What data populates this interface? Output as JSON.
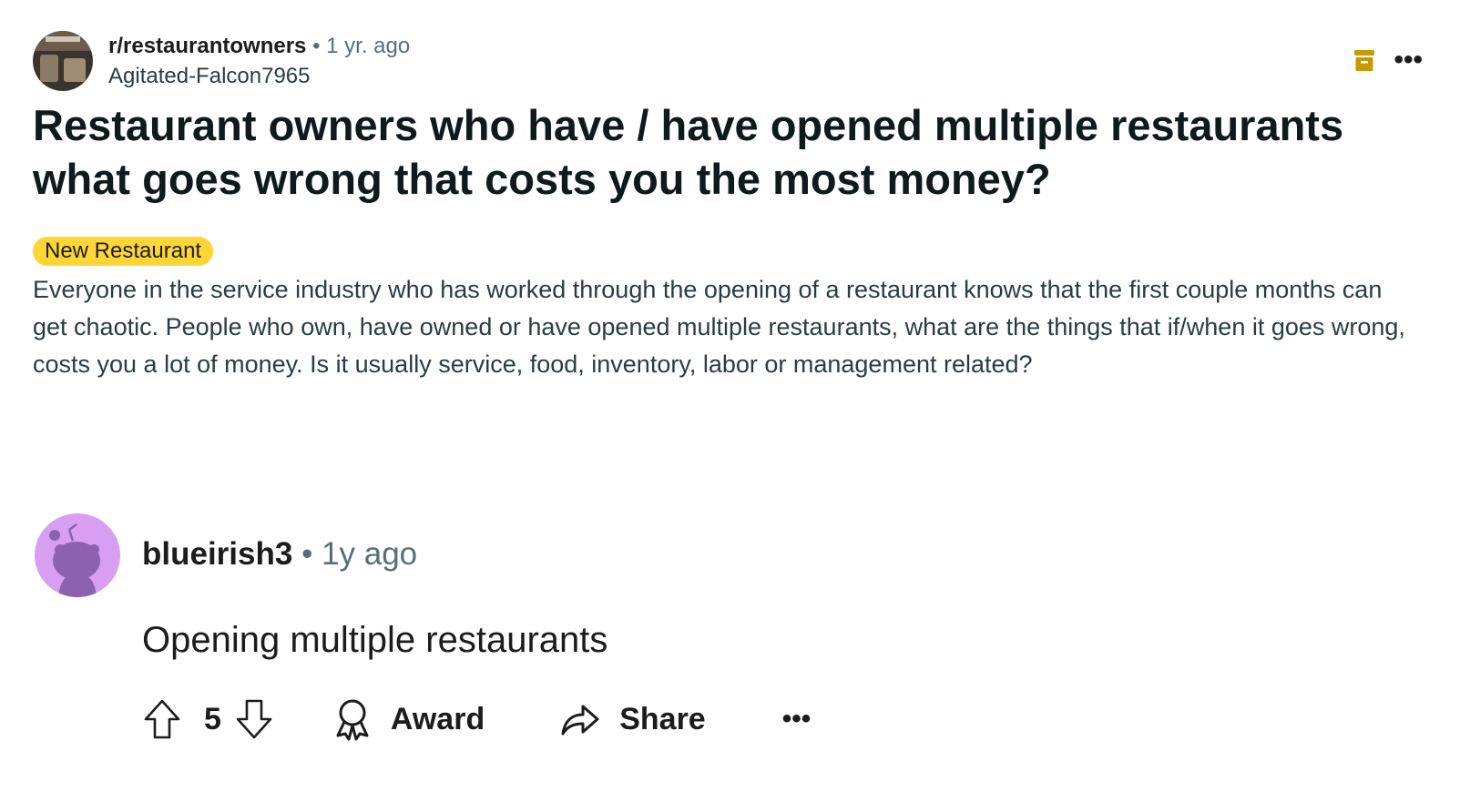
{
  "post": {
    "subreddit": "r/restaurantowners",
    "separator": "•",
    "time": "1 yr. ago",
    "author": "Agitated-Falcon7965",
    "title": "Restaurant owners who have / have opened multiple restaurants what goes wrong that costs you the most money?",
    "flair": "New Restaurant",
    "body": "Everyone in the service industry who has worked through the opening of a restaurant knows that the first couple months can get chaotic. People who own, have owned or have opened multiple restaurants, what are the things that if/when it goes wrong, costs you a lot of money. Is it usually service, food, inventory, labor or management related?",
    "icons": [
      "archive-icon",
      "more-options-icon"
    ]
  },
  "comment": {
    "username": "blueirish3",
    "separator": "•",
    "time": "1y ago",
    "body": "Opening multiple restaurants",
    "vote_count": "5",
    "award_label": "Award",
    "share_label": "Share",
    "icons": [
      "upvote-icon",
      "downvote-icon",
      "award-icon",
      "share-icon",
      "more-options-icon",
      "snoo-avatar-icon"
    ]
  },
  "colors": {
    "flair_bg": "#ffd635",
    "archive_icon": "#c69a00",
    "avatar_bg": "#d79ef2",
    "avatar_snoo": "#8c62b0",
    "meta_gray": "#576f76"
  }
}
